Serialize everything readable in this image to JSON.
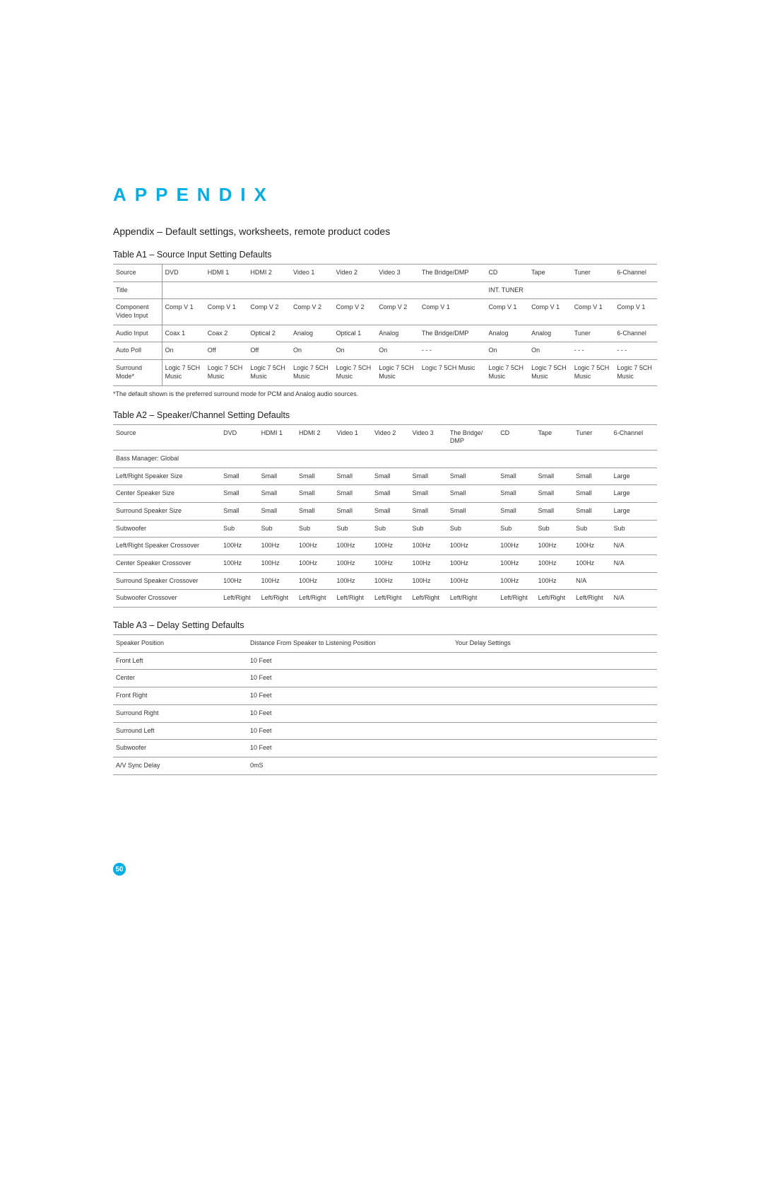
{
  "heading": "APPENDIX",
  "subtitle": "Appendix – Default settings, worksheets, remote product codes",
  "pageNumber": "50",
  "tableA1": {
    "title": "Table A1 – Source Input Setting Defaults",
    "footnote": "*The default shown is the preferred surround mode for PCM and Analog audio sources.",
    "rows": [
      [
        "Source",
        "DVD",
        "HDMI 1",
        "HDMI 2",
        "Video 1",
        "Video 2",
        "Video 3",
        "The Bridge/DMP",
        "CD",
        "Tape",
        "Tuner",
        "6-Channel"
      ],
      [
        "Title",
        "",
        "",
        "",
        "",
        "",
        "",
        "",
        "INT. TUNER",
        "",
        "",
        ""
      ],
      [
        "Component Video Input",
        "Comp V 1",
        "Comp V 1",
        "Comp V 2",
        "Comp V 2",
        "Comp V 2",
        "Comp V 2",
        "Comp V 1",
        "Comp V 1",
        "Comp V 1",
        "Comp V 1",
        "Comp V 1"
      ],
      [
        "Audio Input",
        "Coax 1",
        "Coax 2",
        "Optical 2",
        "Analog",
        "Optical 1",
        "Analog",
        "The Bridge/DMP",
        "Analog",
        "Analog",
        "Tuner",
        "6-Channel"
      ],
      [
        "Auto Poll",
        "On",
        "Off",
        "Off",
        "On",
        "On",
        "On",
        "- - -",
        "On",
        "On",
        "- - -",
        "- - -"
      ],
      [
        "Surround Mode*",
        "Logic 7 5CH Music",
        "Logic 7 5CH Music",
        "Logic 7 5CH Music",
        "Logic 7 5CH Music",
        "Logic 7 5CH Music",
        "Logic 7 5CH Music",
        "Logic 7 5CH Music",
        "Logic 7 5CH Music",
        "Logic 7 5CH Music",
        "Logic 7 5CH Music",
        "Logic 7 5CH Music"
      ]
    ]
  },
  "tableA2": {
    "title": "Table A2 – Speaker/Channel Setting Defaults",
    "rows": [
      [
        "Source",
        "DVD",
        "HDMI 1",
        "HDMI 2",
        "Video 1",
        "Video 2",
        "Video 3",
        "The Bridge/ DMP",
        "CD",
        "Tape",
        "Tuner",
        "6-Channel"
      ],
      [
        "Bass Manager: Global",
        "",
        "",
        "",
        "",
        "",
        "",
        "",
        "",
        "",
        "",
        ""
      ],
      [
        "Left/Right Speaker Size",
        "Small",
        "Small",
        "Small",
        "Small",
        "Small",
        "Small",
        "Small",
        "Small",
        "Small",
        "Small",
        "Large"
      ],
      [
        "Center Speaker Size",
        "Small",
        "Small",
        "Small",
        "Small",
        "Small",
        "Small",
        "Small",
        "Small",
        "Small",
        "Small",
        "Large"
      ],
      [
        "Surround Speaker Size",
        "Small",
        "Small",
        "Small",
        "Small",
        "Small",
        "Small",
        "Small",
        "Small",
        "Small",
        "Small",
        "Large"
      ],
      [
        "Subwoofer",
        "Sub",
        "Sub",
        "Sub",
        "Sub",
        "Sub",
        "Sub",
        "Sub",
        "Sub",
        "Sub",
        "Sub",
        "Sub"
      ],
      [
        "Left/Right Speaker Crossover",
        "100Hz",
        "100Hz",
        "100Hz",
        "100Hz",
        "100Hz",
        "100Hz",
        "100Hz",
        "100Hz",
        "100Hz",
        "100Hz",
        "N/A"
      ],
      [
        "Center Speaker Crossover",
        "100Hz",
        "100Hz",
        "100Hz",
        "100Hz",
        "100Hz",
        "100Hz",
        "100Hz",
        "100Hz",
        "100Hz",
        "100Hz",
        "N/A"
      ],
      [
        "Surround Speaker Crossover",
        "100Hz",
        "100Hz",
        "100Hz",
        "100Hz",
        "100Hz",
        "100Hz",
        "100Hz",
        "100Hz",
        "100Hz",
        "N/A",
        ""
      ],
      [
        "Subwoofer Crossover",
        "Left/Right",
        "Left/Right",
        "Left/Right",
        "Left/Right",
        "Left/Right",
        "Left/Right",
        "Left/Right",
        "Left/Right",
        "Left/Right",
        "Left/Right",
        "N/A"
      ]
    ]
  },
  "tableA3": {
    "title": "Table A3 – Delay Setting Defaults",
    "headers": [
      "Speaker Position",
      "Distance From Speaker to Listening Position",
      "Your Delay Settings"
    ],
    "rows": [
      [
        "Front Left",
        "10 Feet",
        ""
      ],
      [
        "Center",
        "10 Feet",
        ""
      ],
      [
        "Front Right",
        "10 Feet",
        ""
      ],
      [
        "Surround Right",
        "10 Feet",
        ""
      ],
      [
        "Surround Left",
        "10 Feet",
        ""
      ],
      [
        "Subwoofer",
        "10 Feet",
        ""
      ],
      [
        "A/V Sync Delay",
        "0mS",
        ""
      ]
    ]
  }
}
